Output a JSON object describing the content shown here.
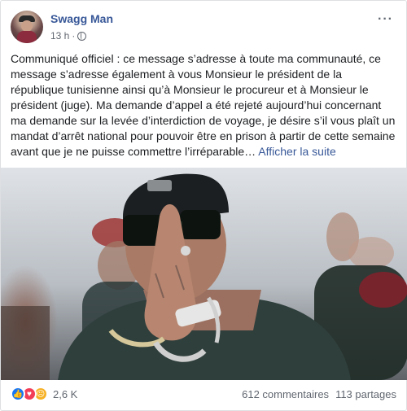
{
  "post": {
    "author": "Swagg Man",
    "time": "13 h",
    "time_separator": "·",
    "more_label": "···",
    "message": "Communiqué officiel : ce message s’adresse à toute ma communauté, ce message s’adresse également à vous Monsieur le président de la république tunisienne ainsi qu’à Monsieur le procureur et à Monsieur le président (juge). Ma demande d’appel a été rejeté aujourd’hui concernant ma demande sur la levée d’interdiction de voyage, je désire s’il vous plaît un mandat d’arrêt national pour pouvoir être en prison à partir de cette semaine avant que je ne puisse commettre l’irréparable…",
    "see_more": "Afficher la suite"
  },
  "footer": {
    "reaction_icons": [
      "like-icon",
      "love-icon",
      "sad-icon"
    ],
    "reaction_count": "2,6 K",
    "comments": "612 commentaires",
    "shares": "113 partages"
  },
  "colors": {
    "link": "#385898",
    "like": "#1877f2",
    "love": "#f33e58",
    "sad": "#f7b125"
  }
}
